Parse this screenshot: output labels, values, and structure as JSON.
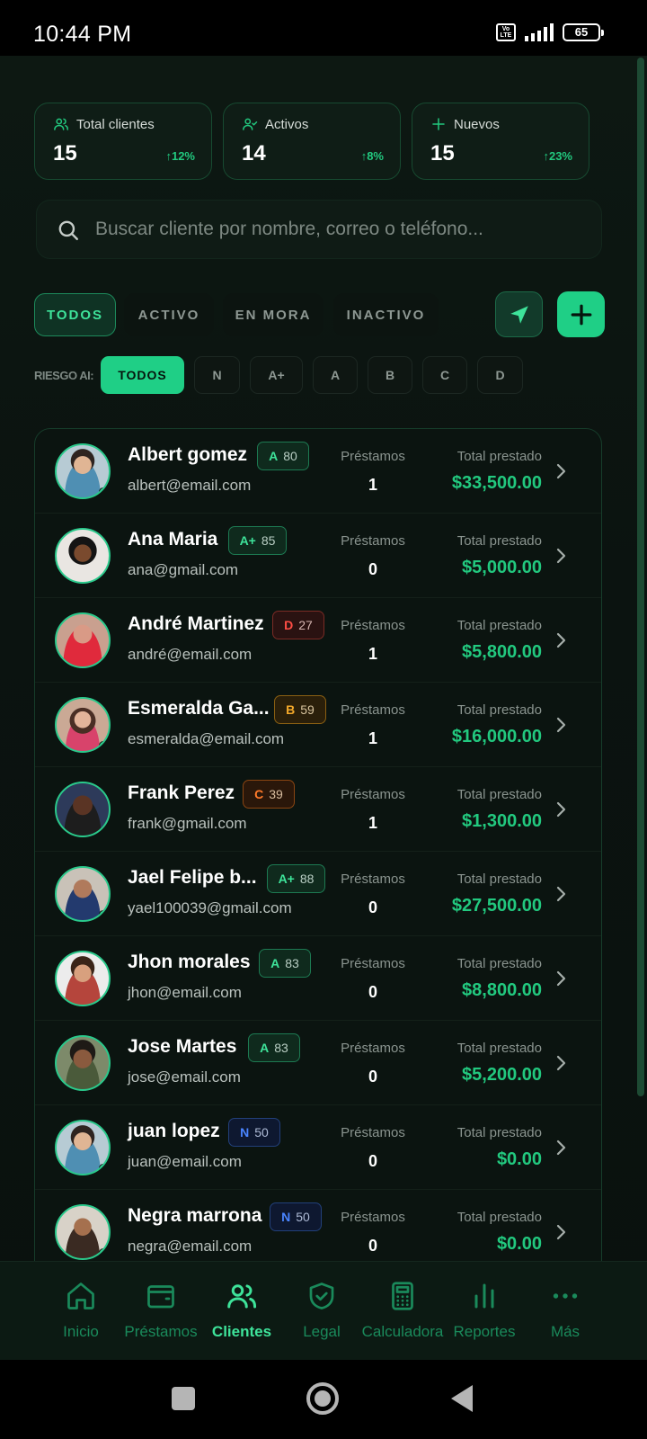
{
  "status_bar": {
    "time": "10:44 PM",
    "volte": "Vo LTE",
    "battery": "65"
  },
  "stats": [
    {
      "label": "Total clientes",
      "value": "15",
      "trend": "↑12%",
      "icon": "users-icon"
    },
    {
      "label": "Activos",
      "value": "14",
      "trend": "↑8%",
      "icon": "user-check-icon"
    },
    {
      "label": "Nuevos",
      "value": "15",
      "trend": "↑23%",
      "icon": "plus-icon"
    }
  ],
  "search": {
    "placeholder": "Buscar cliente por nombre, correo o teléfono..."
  },
  "status_filters": [
    "TODOS",
    "ACTIVO",
    "EN MORA",
    "INACTIVO"
  ],
  "status_filter_selected": "TODOS",
  "risk_filter": {
    "label": "RIESGO AI:",
    "options": [
      "TODOS",
      "N",
      "A+",
      "A",
      "B",
      "C",
      "D"
    ],
    "selected": "TODOS"
  },
  "list_labels": {
    "loans": "Préstamos",
    "total": "Total prestado"
  },
  "clients": [
    {
      "name": "Albert gomez",
      "email": "albert@email.com",
      "grade": "A",
      "score": "80",
      "loans": "1",
      "total": "$33,500.00"
    },
    {
      "name": "Ana Maria",
      "email": "ana@gmail.com",
      "grade": "A+",
      "score": "85",
      "loans": "0",
      "total": "$5,000.00"
    },
    {
      "name": "André Martinez",
      "email": "andré@email.com",
      "grade": "D",
      "score": "27",
      "loans": "1",
      "total": "$5,800.00"
    },
    {
      "name": "Esmeralda Ga...",
      "email": "esmeralda@email.com",
      "grade": "B",
      "score": "59",
      "loans": "1",
      "total": "$16,000.00"
    },
    {
      "name": "Frank Perez",
      "email": "frank@gmail.com",
      "grade": "C",
      "score": "39",
      "loans": "1",
      "total": "$1,300.00"
    },
    {
      "name": "Jael Felipe b...",
      "email": "yael100039@gmail.com",
      "grade": "A+",
      "score": "88",
      "loans": "0",
      "total": "$27,500.00"
    },
    {
      "name": "Jhon morales",
      "email": "jhon@email.com",
      "grade": "A",
      "score": "83",
      "loans": "0",
      "total": "$8,800.00"
    },
    {
      "name": "Jose Martes",
      "email": "jose@email.com",
      "grade": "A",
      "score": "83",
      "loans": "0",
      "total": "$5,200.00"
    },
    {
      "name": "juan lopez",
      "email": "juan@email.com",
      "grade": "N",
      "score": "50",
      "loans": "0",
      "total": "$0.00"
    },
    {
      "name": "Negra marrona",
      "email": "negra@email.com",
      "grade": "N",
      "score": "50",
      "loans": "0",
      "total": "$0.00"
    }
  ],
  "bottom_nav": [
    {
      "label": "Inicio",
      "icon": "home-icon"
    },
    {
      "label": "Préstamos",
      "icon": "wallet-icon"
    },
    {
      "label": "Clientes",
      "icon": "users-icon"
    },
    {
      "label": "Legal",
      "icon": "shield-check-icon"
    },
    {
      "label": "Calculadora",
      "icon": "calculator-icon"
    },
    {
      "label": "Reportes",
      "icon": "bar-chart-icon"
    },
    {
      "label": "Más",
      "icon": "more-dots-icon"
    }
  ],
  "bottom_nav_active": "Clientes",
  "colors": {
    "accent": "#1fcf86",
    "accent_text": "#22c97f",
    "background": "#0b1310",
    "risk_A": "#3ee39a",
    "risk_B": "#f4a92a",
    "risk_C": "#ff7a2a",
    "risk_D": "#ff4d45",
    "risk_N": "#4a85ff"
  }
}
